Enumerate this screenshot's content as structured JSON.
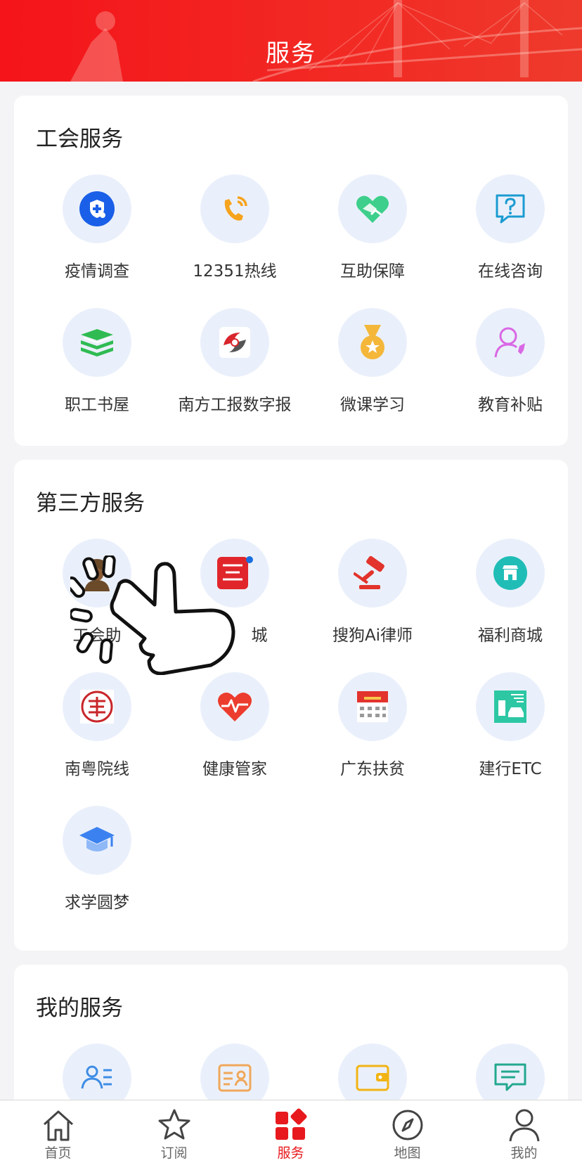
{
  "header": {
    "title": "服务"
  },
  "sections": {
    "union": {
      "title": "工会服务",
      "items": [
        {
          "label": "疫情调查",
          "icon": "shield-plus-icon"
        },
        {
          "label": "12351热线",
          "icon": "phone-ring-icon"
        },
        {
          "label": "互助保障",
          "icon": "handshake-heart-icon"
        },
        {
          "label": "在线咨询",
          "icon": "question-bubble-icon"
        },
        {
          "label": "职工书屋",
          "icon": "book-stack-icon"
        },
        {
          "label": "南方工报数字报",
          "icon": "newspaper-logo-icon"
        },
        {
          "label": "微课学习",
          "icon": "medal-icon"
        },
        {
          "label": "教育补贴",
          "icon": "person-rocket-icon"
        }
      ]
    },
    "third_party": {
      "title": "第三方服务",
      "items": [
        {
          "label": "工会助",
          "icon": "worker-avatar-icon"
        },
        {
          "label": "城",
          "icon": "mall-logo-icon"
        },
        {
          "label": "搜狗Ai律师",
          "icon": "gavel-icon"
        },
        {
          "label": "福利商城",
          "icon": "store-icon"
        },
        {
          "label": "南粤院线",
          "icon": "cinema-seal-icon"
        },
        {
          "label": "健康管家",
          "icon": "heart-pulse-icon"
        },
        {
          "label": "广东扶贫",
          "icon": "poverty-app-icon"
        },
        {
          "label": "建行ETC",
          "icon": "etc-car-icon"
        },
        {
          "label": "求学圆梦",
          "icon": "graduation-cap-icon"
        }
      ]
    },
    "mine": {
      "title": "我的服务",
      "items": [
        {
          "label": "",
          "icon": "profile-card-icon"
        },
        {
          "label": "",
          "icon": "id-card-icon"
        },
        {
          "label": "",
          "icon": "wallet-icon"
        },
        {
          "label": "",
          "icon": "message-list-icon"
        }
      ]
    }
  },
  "tabbar": {
    "active": "服务",
    "items": [
      {
        "label": "首页",
        "icon": "home-icon"
      },
      {
        "label": "订阅",
        "icon": "star-icon"
      },
      {
        "label": "服务",
        "icon": "grid-diamond-icon"
      },
      {
        "label": "地图",
        "icon": "compass-icon"
      },
      {
        "label": "我的",
        "icon": "user-icon"
      }
    ]
  },
  "colors": {
    "brand_red": "#e8191d",
    "circle_bg": "#eaf0fb"
  }
}
